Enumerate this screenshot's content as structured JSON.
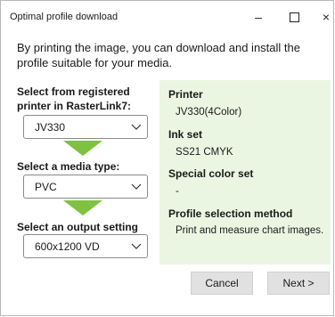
{
  "window": {
    "title": "Optimal profile download",
    "min_glyph": "–",
    "close_glyph": "×"
  },
  "description": "By printing the image, you can download and install the profile suitable for your media.",
  "steps": {
    "printer_label": "Select from registered printer in RasterLink7:",
    "printer_value": "JV330",
    "media_label": "Select a media type:",
    "media_value": "PVC",
    "output_label": "Select an output setting",
    "output_value": "600x1200 VD"
  },
  "info": {
    "printer_heading": "Printer",
    "printer_value": "JV330(4Color)",
    "inkset_heading": "Ink set",
    "inkset_value": "SS21 CMYK",
    "special_heading": "Special color set",
    "special_value": "-",
    "method_heading": "Profile selection method",
    "method_value": "Print and measure chart images."
  },
  "buttons": {
    "cancel": "Cancel",
    "next": "Next >"
  },
  "colors": {
    "arrow": "#7fc242",
    "info_panel": "#eaf6e2"
  },
  "icons": {
    "dropdown": "chevron-down-icon",
    "step_arrow": "arrow-down-icon"
  }
}
